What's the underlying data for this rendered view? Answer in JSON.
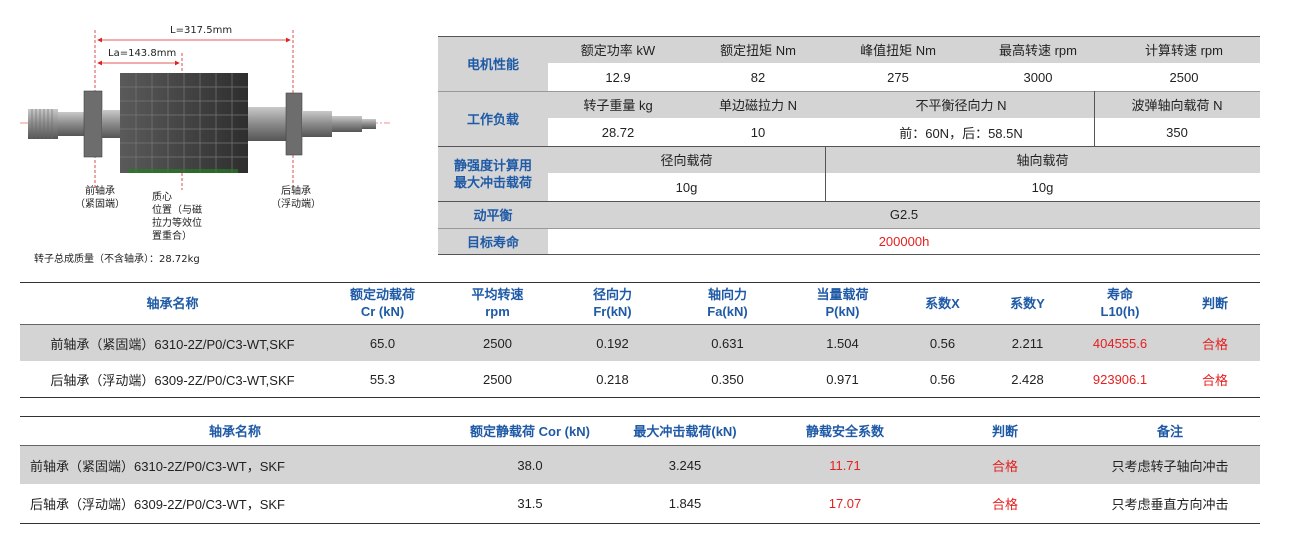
{
  "figure": {
    "dim_L": "L=317.5mm",
    "dim_La": "La=143.8mm",
    "front_bearing": [
      "前轴承",
      "（紧固端）"
    ],
    "center_mass": [
      "质心",
      "位置（与磁",
      "拉力等效位",
      "置重合）"
    ],
    "rear_bearing": [
      "后轴承",
      "（浮动端）"
    ],
    "total_mass": "转子总成质量（不含轴承）：28.72kg"
  },
  "params": {
    "motor_perf_label": "电机性能",
    "motor_headers": [
      "额定功率 kW",
      "额定扭矩 Nm",
      "峰值扭矩 Nm",
      "最高转速 rpm",
      "计算转速 rpm"
    ],
    "motor_values": [
      "12.9",
      "82",
      "275",
      "3000",
      "2500"
    ],
    "load_label": "工作负载",
    "load_headers": [
      "转子重量 kg",
      "单边磁拉力 N",
      "不平衡径向力 N",
      "波弹轴向载荷 N"
    ],
    "load_values": [
      "28.72",
      "10",
      "前：60N，后：58.5N",
      "350"
    ],
    "static_label": [
      "静强度计算用",
      "最大冲击载荷"
    ],
    "static_headers": [
      "径向载荷",
      "轴向载荷"
    ],
    "static_values": [
      "10g",
      "10g"
    ],
    "balance_label": "动平衡",
    "balance_value": "G2.5",
    "life_label": "目标寿命",
    "life_value": "200000h"
  },
  "life_table": {
    "headers": [
      [
        "轴承名称"
      ],
      [
        "额定动载荷",
        "Cr (kN)"
      ],
      [
        "平均转速",
        "rpm"
      ],
      [
        "径向力",
        "Fr(kN)"
      ],
      [
        "轴向力",
        "Fa(kN)"
      ],
      [
        "当量载荷",
        "P(kN)"
      ],
      [
        "系数X"
      ],
      [
        "系数Y"
      ],
      [
        "寿命",
        "L10(h)"
      ],
      [
        "判断"
      ]
    ],
    "rows": [
      [
        "前轴承（紧固端）6310-2Z/P0/C3-WT,SKF",
        "65.0",
        "2500",
        "0.192",
        "0.631",
        "1.504",
        "0.56",
        "2.211",
        "404555.6",
        "合格"
      ],
      [
        "后轴承（浮动端）6309-2Z/P0/C3-WT,SKF",
        "55.3",
        "2500",
        "0.218",
        "0.350",
        "0.971",
        "0.56",
        "2.428",
        "923906.1",
        "合格"
      ]
    ]
  },
  "static_table": {
    "headers": [
      "轴承名称",
      "额定静载荷 Cor (kN)",
      "最大冲击载荷(kN)",
      "静载安全系数",
      "判断",
      "备注"
    ],
    "rows": [
      [
        "前轴承（紧固端）6310-2Z/P0/C3-WT，SKF",
        "38.0",
        "3.245",
        "11.71",
        "合格",
        "只考虑转子轴向冲击"
      ],
      [
        "后轴承（浮动端）6309-2Z/P0/C3-WT，SKF",
        "31.5",
        "1.845",
        "17.07",
        "合格",
        "只考虑垂直方向冲击"
      ]
    ]
  },
  "colors": {
    "accent_blue": "#1f5aa6",
    "alert_red": "#e52020",
    "row_gray": "#d4d4d4",
    "rotor_dark": "#3a3a3a"
  }
}
